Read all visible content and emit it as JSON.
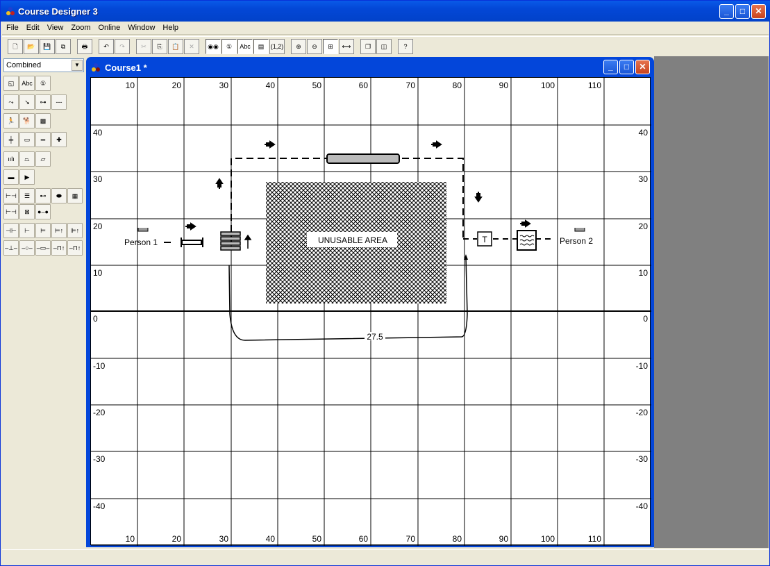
{
  "app": {
    "title": "Course Designer 3"
  },
  "menu": [
    "File",
    "Edit",
    "View",
    "Zoom",
    "Online",
    "Window",
    "Help"
  ],
  "toolbar": [
    {
      "name": "new",
      "glyph": "🗋"
    },
    {
      "name": "open",
      "glyph": "📂"
    },
    {
      "name": "save",
      "glyph": "💾"
    },
    {
      "name": "save-all",
      "glyph": "⧉"
    },
    {
      "name": "print",
      "glyph": "🖶"
    },
    {
      "name": "undo",
      "glyph": "↶"
    },
    {
      "name": "redo",
      "glyph": "↷"
    },
    {
      "name": "cut",
      "glyph": "✂"
    },
    {
      "name": "copy",
      "glyph": "⎘"
    },
    {
      "name": "paste",
      "glyph": "📋"
    },
    {
      "name": "delete",
      "glyph": "✕"
    },
    {
      "name": "show-paths",
      "glyph": "◉◉"
    },
    {
      "name": "show-numbers",
      "glyph": "①"
    },
    {
      "name": "show-labels",
      "glyph": "Abc"
    },
    {
      "name": "show-grid",
      "glyph": "▤"
    },
    {
      "name": "coordinates",
      "glyph": "(1,2)"
    },
    {
      "name": "zoom-in",
      "glyph": "⊕"
    },
    {
      "name": "zoom-out",
      "glyph": "⊖"
    },
    {
      "name": "zoom-fit",
      "glyph": "⊞"
    },
    {
      "name": "zoom-width",
      "glyph": "⟷"
    },
    {
      "name": "cascade",
      "glyph": "❐"
    },
    {
      "name": "tile",
      "glyph": "◫"
    },
    {
      "name": "help",
      "glyph": "?"
    }
  ],
  "left_panel": {
    "category_select": "Combined",
    "tools": [
      [
        "◱",
        "Abc",
        "①"
      ],
      [
        "⤳",
        "↘",
        "⊶",
        "---"
      ],
      [
        "🏃",
        "🐕",
        "▩"
      ],
      [
        "╪",
        "▭",
        "═",
        "✚"
      ],
      [
        "ıılı",
        "⏢",
        "▱"
      ],
      [
        "▬",
        "▶"
      ],
      [
        "⊢⊣",
        "☰",
        "⊷",
        "⬬",
        "▦"
      ],
      [
        "⊢⊣",
        "⊠",
        "●–●"
      ],
      [
        "⊣⊢",
        "⊢",
        "⊨",
        "⊨↑",
        "⊫↑"
      ],
      [
        "–⊥–",
        "–○–",
        "–▭–",
        "–⊓↑",
        "–⊓↑"
      ]
    ]
  },
  "document": {
    "title": "Course1 *",
    "x_ticks": [
      "10",
      "20",
      "30",
      "40",
      "50",
      "60",
      "70",
      "80",
      "90",
      "100",
      "110"
    ],
    "y_ticks": [
      "40",
      "30",
      "20",
      "10",
      "0",
      "-10",
      "-20",
      "-30",
      "-40"
    ],
    "labels": {
      "person1": "Person 1",
      "person2": "Person 2",
      "unusable": "UNUSABLE AREA",
      "distance": "27.5",
      "table_marker": "T"
    }
  }
}
